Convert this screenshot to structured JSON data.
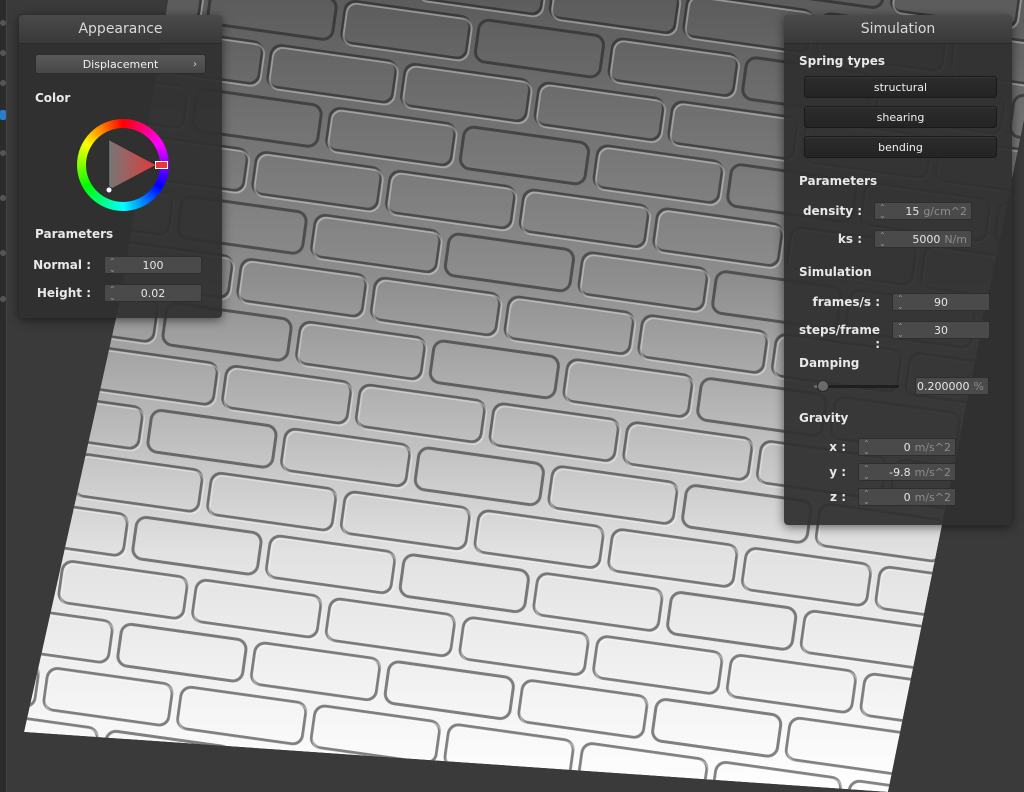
{
  "appearance": {
    "title": "Appearance",
    "shader_select": "Displacement",
    "color_label": "Color",
    "params_label": "Parameters",
    "normal": {
      "label": "Normal :",
      "value": "100"
    },
    "height": {
      "label": "Height :",
      "value": "0.02"
    }
  },
  "simulation": {
    "title": "Simulation",
    "spring_types_label": "Spring types",
    "springs": [
      "structural",
      "shearing",
      "bending"
    ],
    "params_label": "Parameters",
    "density": {
      "label": "density :",
      "value": "15",
      "unit": "g/cm^2"
    },
    "ks": {
      "label": "ks :",
      "value": "5000",
      "unit": "N/m"
    },
    "sim_label": "Simulation",
    "fps": {
      "label": "frames/s :",
      "value": "90"
    },
    "steps": {
      "label": "steps/frame :",
      "value": "30"
    },
    "damping_label": "Damping",
    "damping": {
      "value": "0.200000",
      "unit": "%",
      "level": 0.1
    },
    "gravity_label": "Gravity",
    "gx": {
      "label": "x :",
      "value": "0",
      "unit": "m/s^2"
    },
    "gy": {
      "label": "y :",
      "value": "-9.8",
      "unit": "m/s^2"
    },
    "gz": {
      "label": "z :",
      "value": "0",
      "unit": "m/s^2"
    }
  },
  "colors": {
    "panel_bg": "#303030",
    "selected_color": "#e23a3a",
    "accent": "#2a7dc9"
  },
  "icons": [
    "chevron-right-icon",
    "spinner-arrows-icon",
    "color-wheel-icon",
    "slider-knob-icon"
  ]
}
